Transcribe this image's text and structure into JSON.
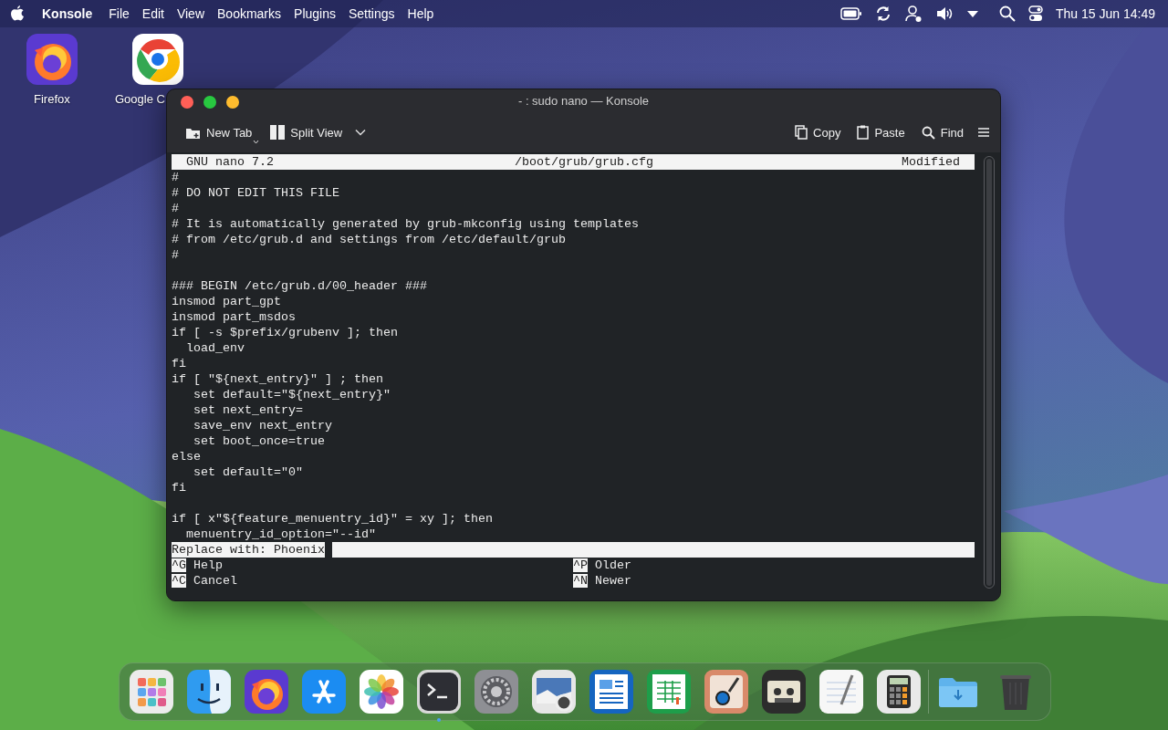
{
  "menubar": {
    "app": "Konsole",
    "menus": [
      "File",
      "Edit",
      "View",
      "Bookmarks",
      "Plugins",
      "Settings",
      "Help"
    ],
    "clock": "Thu 15 Jun 14:49"
  },
  "desktop_icons": [
    {
      "label": "Firefox",
      "kind": "firefox"
    },
    {
      "label": "Google C",
      "kind": "chrome"
    }
  ],
  "window": {
    "title": "- : sudo nano — Konsole",
    "controls": [
      {
        "color": "#ff5f57"
      },
      {
        "color": "#28c840"
      },
      {
        "color": "#febc2e"
      }
    ],
    "toolbar": {
      "left": [
        {
          "label": "New Tab",
          "kind": "new-tab"
        },
        {
          "label": "Split View",
          "kind": "split"
        }
      ],
      "right": [
        {
          "label": "Copy",
          "kind": "copy"
        },
        {
          "label": "Paste",
          "kind": "paste"
        },
        {
          "label": "Find",
          "kind": "find"
        }
      ]
    }
  },
  "nano": {
    "version": "GNU nano 7.2",
    "file": "/boot/grub/grub.cfg",
    "status": "Modified",
    "blocks": [
      [
        "#",
        "# DO NOT EDIT THIS FILE",
        "#",
        "# It is automatically generated by grub-mkconfig using templates",
        "# from /etc/grub.d and settings from /etc/default/grub",
        "#"
      ],
      [
        "### BEGIN /etc/grub.d/00_header ###",
        "insmod part_gpt",
        "insmod part_msdos",
        "if [ -s $prefix/grubenv ]; then",
        "  load_env",
        "fi",
        "if [ \"${next_entry}\" ] ; then",
        "   set default=\"${next_entry}\"",
        "   set next_entry=",
        "   save_env next_entry",
        "   set boot_once=true",
        "else",
        "   set default=\"0\"",
        "fi"
      ],
      [
        "if [ x\"${feature_menuentry_id}\" = xy ]; then",
        "  menuentry_id_option=\"--id\""
      ]
    ],
    "prompt": {
      "label": "Replace with:",
      "value": "Phoenix"
    },
    "shortcuts": [
      {
        "key": "^G",
        "label": "Help"
      },
      {
        "key": "^P",
        "label": "Older"
      },
      {
        "key": "^C",
        "label": "Cancel"
      },
      {
        "key": "^N",
        "label": "Newer"
      }
    ]
  },
  "dock": {
    "items": [
      {
        "kind": "launchpad",
        "running": false
      },
      {
        "kind": "finder",
        "running": false
      },
      {
        "kind": "firefox",
        "running": false
      },
      {
        "kind": "appstore",
        "running": false
      },
      {
        "kind": "photos",
        "running": false
      },
      {
        "kind": "terminal",
        "running": true
      },
      {
        "kind": "settings",
        "running": false
      },
      {
        "kind": "preview",
        "running": false
      },
      {
        "kind": "writer",
        "running": false
      },
      {
        "kind": "sheet",
        "running": false
      },
      {
        "kind": "paint",
        "running": false
      },
      {
        "kind": "cassette",
        "running": false
      },
      {
        "kind": "notes",
        "running": false
      },
      {
        "kind": "calculator",
        "running": false
      },
      {
        "kind": "separator"
      },
      {
        "kind": "folder",
        "running": false
      },
      {
        "kind": "trash",
        "running": false
      }
    ]
  }
}
